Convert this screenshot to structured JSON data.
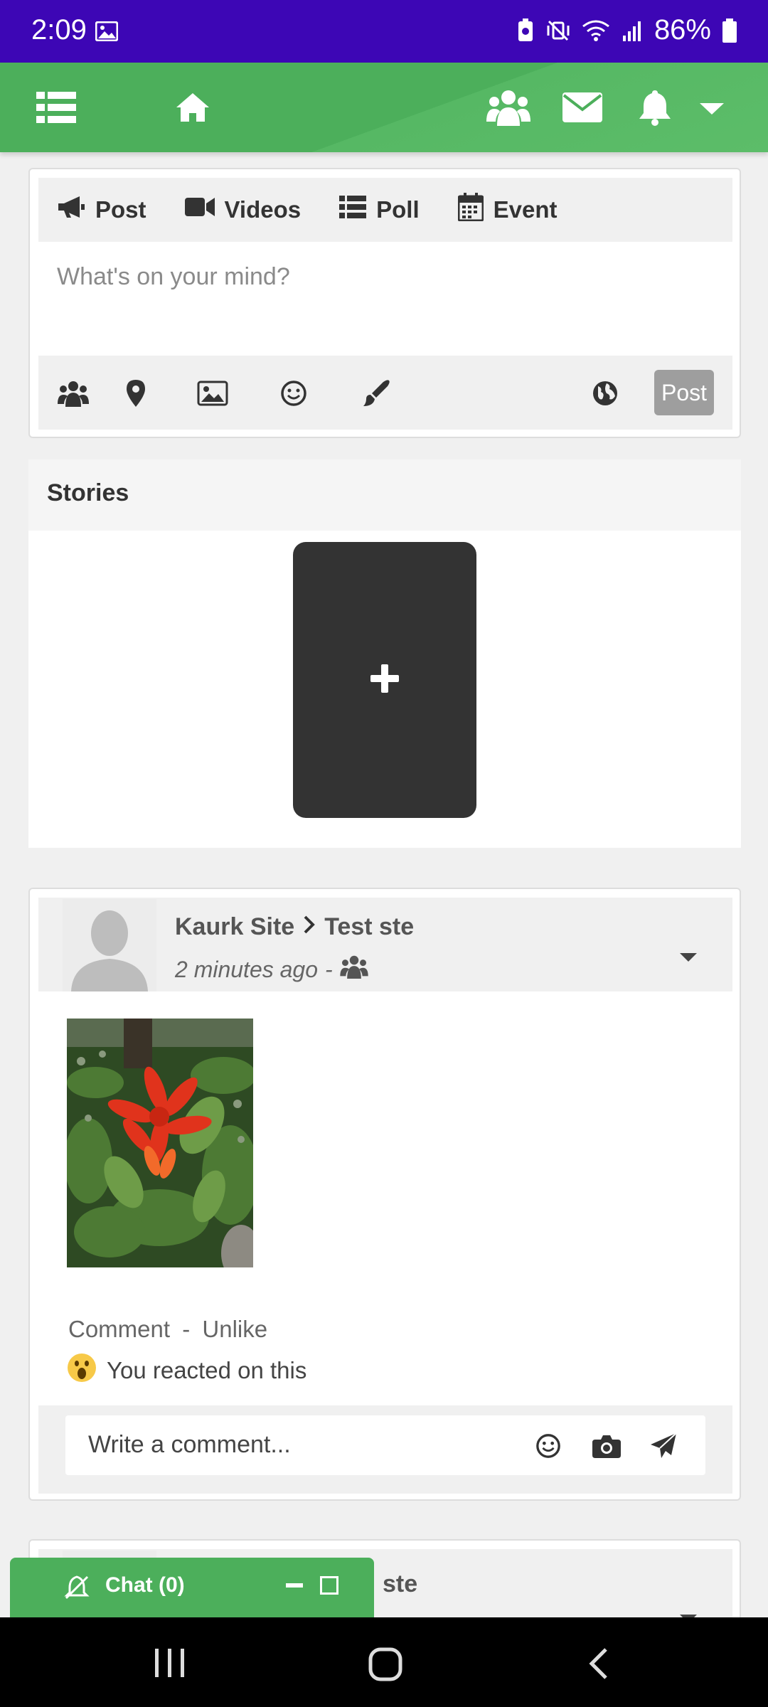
{
  "status_bar": {
    "time": "2:09",
    "battery": "86%"
  },
  "composer": {
    "tabs": [
      {
        "label": "Post",
        "icon": "megaphone-icon"
      },
      {
        "label": "Videos",
        "icon": "video-camera-icon"
      },
      {
        "label": "Poll",
        "icon": "list-icon"
      },
      {
        "label": "Event",
        "icon": "calendar-icon"
      }
    ],
    "placeholder": "What's on your mind?",
    "post_button": "Post"
  },
  "stories": {
    "title": "Stories",
    "add_symbol": "+"
  },
  "post": {
    "author": "Kaurk Site",
    "target": "Test ste",
    "time_ago": "2 minutes ago",
    "separator": "-",
    "comment_label": "Comment",
    "unlike_label": "Unlike",
    "action_separator": "-",
    "reaction_text": "You reacted on this",
    "comment_placeholder": "Write a comment..."
  },
  "post2": {
    "target": "ste"
  },
  "chat": {
    "label": "Chat (0)"
  },
  "colors": {
    "status_bar": "#3d06b5",
    "brand_green": "#4caf5b",
    "post_button_disabled": "#9e9e9e"
  }
}
